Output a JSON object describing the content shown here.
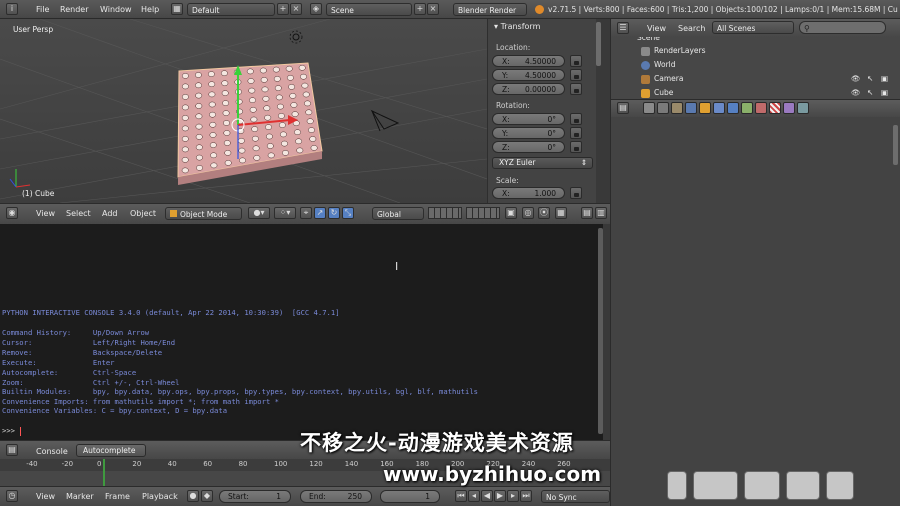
{
  "topbar": {
    "menus": [
      "File",
      "Render",
      "Window",
      "Help"
    ],
    "screen_layout": "Default",
    "scene": "Scene",
    "render_engine": "Blender Render",
    "stats": "v2.71.5 | Verts:800 | Faces:600 | Tris:1,200 | Objects:100/102 | Lamps:0/1 | Mem:15.68M | Cu"
  },
  "viewport": {
    "view_name": "User Persp",
    "active_object": "(1) Cube"
  },
  "npanel": {
    "section": "Transform",
    "location_label": "Location:",
    "location": [
      {
        "k": "X:",
        "v": "4.50000"
      },
      {
        "k": "Y:",
        "v": "4.50000"
      },
      {
        "k": "Z:",
        "v": "0.00000"
      }
    ],
    "rotation_label": "Rotation:",
    "rotation": [
      {
        "k": "X:",
        "v": "0°"
      },
      {
        "k": "Y:",
        "v": "0°"
      },
      {
        "k": "Z:",
        "v": "0°"
      }
    ],
    "rotation_mode": "XYZ Euler",
    "scale_label": "Scale:",
    "scale": [
      {
        "k": "X:",
        "v": "1.000"
      }
    ]
  },
  "view3d_header": {
    "menus": [
      "View",
      "Select",
      "Add",
      "Object"
    ],
    "mode": "Object Mode",
    "orientation": "Global"
  },
  "console": {
    "lines": [
      "PYTHON INTERACTIVE CONSOLE 3.4.0 (default, Apr 22 2014, 10:30:39)  [GCC 4.7.1]",
      "",
      "Command History:     Up/Down Arrow",
      "Cursor:              Left/Right Home/End",
      "Remove:              Backspace/Delete",
      "Execute:             Enter",
      "Autocomplete:        Ctrl-Space",
      "Zoom:                Ctrl +/-, Ctrl-Wheel",
      "Builtin Modules:     bpy, bpy.data, bpy.ops, bpy.props, bpy.types, bpy.context, bpy.utils, bgl, blf, mathutils",
      "Convenience Imports: from mathutils import *; from math import *",
      "Convenience Variables: C = bpy.context, D = bpy.data"
    ],
    "prompt": ">>> "
  },
  "console_header": {
    "menu": "Console",
    "autocomplete_label": "Autocomplete"
  },
  "timeline": {
    "ticks": [
      "-40",
      "-20",
      "0",
      "20",
      "40",
      "60",
      "80",
      "100",
      "120",
      "140",
      "160",
      "180",
      "200",
      "220",
      "240",
      "260"
    ],
    "current_frame_value": 0
  },
  "timeline_header": {
    "menus": [
      "View",
      "Marker",
      "Frame",
      "Playback"
    ],
    "start_label": "Start:",
    "start": "1",
    "end_label": "End:",
    "end": "250",
    "current": "1",
    "sync": "No Sync"
  },
  "outliner": {
    "menus": [
      "View",
      "Search"
    ],
    "display_mode": "All Scenes",
    "rows": [
      "Scene",
      "RenderLayers",
      "World",
      "Camera",
      "Cube"
    ]
  },
  "watermark": {
    "line1": "不移之火-动漫游戏美术资源",
    "line2": "www.byzhihuo.com"
  }
}
